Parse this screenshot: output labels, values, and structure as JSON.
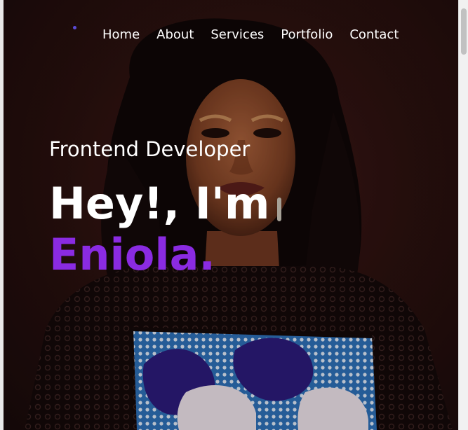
{
  "nav": {
    "items": [
      {
        "label": "Home"
      },
      {
        "label": "About"
      },
      {
        "label": "Services"
      },
      {
        "label": "Portfolio"
      },
      {
        "label": "Contact"
      }
    ]
  },
  "hero": {
    "subtitle": "Frontend Developer",
    "headline": "Hey!, I'm",
    "name": "Eniola."
  },
  "colors": {
    "accent": "#8a2be2",
    "logo_dot": "#5b4bd6",
    "text": "#ffffff",
    "background": "#2a100e"
  }
}
